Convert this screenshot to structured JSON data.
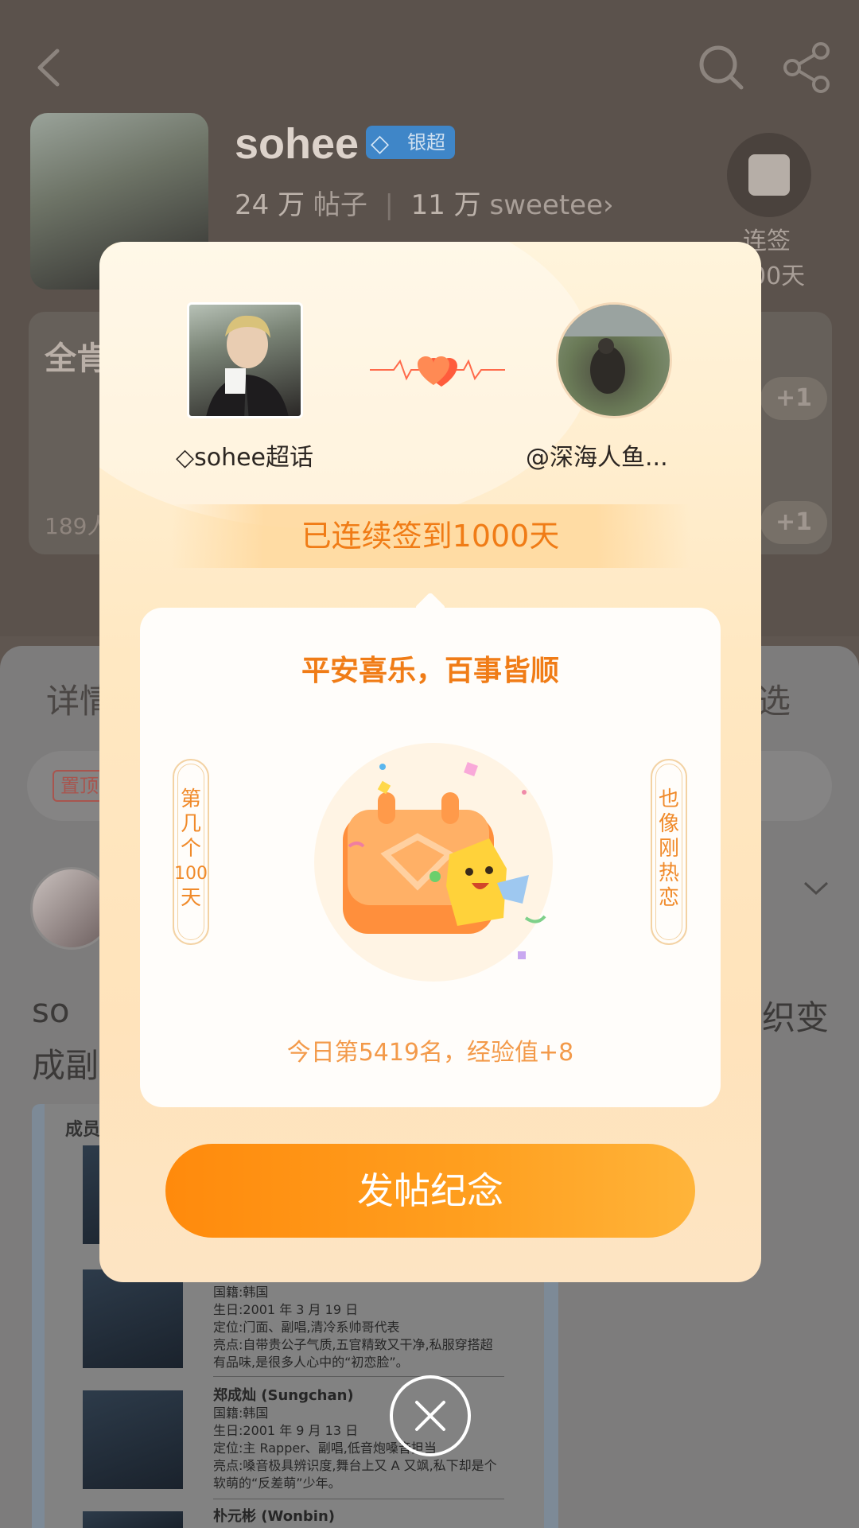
{
  "background": {
    "topbar": {
      "back_icon": "chevron-left-icon",
      "search_icon": "search-icon",
      "share_icon": "share-icon"
    },
    "profile": {
      "name": "sohee",
      "badge_label": "银超",
      "posts_count": "24 万",
      "posts_label": "帖子",
      "fans_count": "11 万",
      "fans_label": "sweetee",
      "sign_label": "连签",
      "sign_days": "00天"
    },
    "card": {
      "title": "全肯",
      "count_text": "189人",
      "plus_label": "+1"
    },
    "tabs": {
      "left_label": "详情",
      "right_label": "选"
    },
    "pin_label": "置顶",
    "post": {
      "line1": "so",
      "line2": "成副",
      "line_right": "织变"
    },
    "sheet": {
      "header": "成员",
      "members": [
        {
          "name": "",
          "lines": [
            "国籍:韩国",
            "生日:2001 年 3 月 19 日",
            "定位:门面、副唱,清冷系帅哥代表",
            "亮点:自带贵公子气质,五官精致又干净,私服穿搭超",
            "有品味,是很多人心中的“初恋脸”。"
          ]
        },
        {
          "name": "郑成灿 (Sungchan)",
          "lines": [
            "国籍:韩国",
            "生日:2001 年 9 月 13 日",
            "定位:主 Rapper、副唱,低音炮嗓音担当",
            "亮点:嗓音极具辨识度,舞台上又 A 又飒,私下却是个",
            "软萌的“反差萌”少年。"
          ]
        },
        {
          "name": "朴元彬 (Wonbin)",
          "lines": []
        }
      ]
    }
  },
  "modal": {
    "left_label": "sohee超话",
    "right_label": "@深海人鱼...",
    "streak_text": "已连续签到1000天",
    "card_title": "平安喜乐，百事皆顺",
    "left_tag": [
      "第",
      "几",
      "个",
      "100",
      "天"
    ],
    "right_tag": [
      "也",
      "像",
      "刚",
      "热",
      "恋"
    ],
    "rank_text": "今日第5419名，经验值+8",
    "post_button": "发帖纪念"
  },
  "close_icon": "close-icon",
  "colors": {
    "accent_orange": "#f07c16",
    "button_orange": "#ff8a0c",
    "modal_bg": "#ffe8c2"
  }
}
